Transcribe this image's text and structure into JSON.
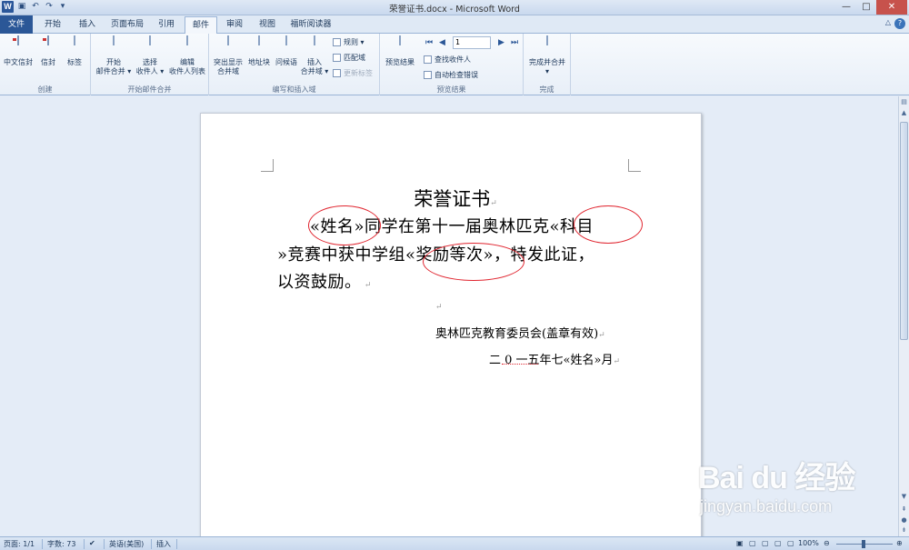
{
  "window": {
    "title": "荣誉证书.docx - Microsoft Word",
    "app_icon": "W",
    "controls": [
      "—",
      "□",
      "✕"
    ]
  },
  "tabs": [
    {
      "label": "文件"
    },
    {
      "label": "开始"
    },
    {
      "label": "插入"
    },
    {
      "label": "页面布局"
    },
    {
      "label": "引用"
    },
    {
      "label": "邮件"
    },
    {
      "label": "审阅"
    },
    {
      "label": "视图"
    },
    {
      "label": "福昕阅读器"
    }
  ],
  "active_tab": "邮件",
  "ribbon": {
    "groups": {
      "create": {
        "label": "创建",
        "buttons": [
          "中文信封",
          "信封",
          "标签"
        ]
      },
      "start_merge": {
        "label": "开始邮件合并",
        "start": {
          "line1": "开始",
          "line2": "邮件合并 ▾"
        },
        "select": {
          "line1": "选择",
          "line2": "收件人 ▾"
        },
        "edit": {
          "line1": "编辑",
          "line2": "收件人列表"
        }
      },
      "write_insert": {
        "label": "编写和插入域",
        "highlight": {
          "line1": "突出显示",
          "line2": "合并域"
        },
        "address_block": "地址块",
        "greeting": "问候语",
        "insert_field": {
          "line1": "插入",
          "line2": "合并域 ▾"
        },
        "rules": "规则 ▾",
        "match_fields": "匹配域",
        "update_labels": "更新标签"
      },
      "preview": {
        "label": "预览结果",
        "preview_button": "预览结果",
        "record_number": "1",
        "find_recipient": "查找收件人",
        "auto_check": "自动检查错误"
      },
      "finish": {
        "label": "完成",
        "finish_merge": {
          "line1": "完成并合并",
          "line2": "▾"
        }
      }
    }
  },
  "document": {
    "title": "荣誉证书",
    "line1": "«姓名»同学在第十一届奥林匹克«科目",
    "line2": "»竞赛中获中学组«奖励等次»，特发此证，",
    "line3": "以资鼓励。",
    "signature": "奥林匹克教育委员会(盖章有效)",
    "date": "二 0 一五年七«姓名»月"
  },
  "status_bar": {
    "page": "页面: 1/1",
    "words": "字数: 73",
    "language": "英语(美国)",
    "mode": "插入",
    "zoom": "100%"
  },
  "watermark": {
    "logo": "Bai du 经验",
    "url": "jingyan.baidu.com"
  },
  "colors": {
    "file_tab": "#2b5797",
    "annotation_red": "#e0252f",
    "ribbon_bg": "#f3f7fc"
  }
}
